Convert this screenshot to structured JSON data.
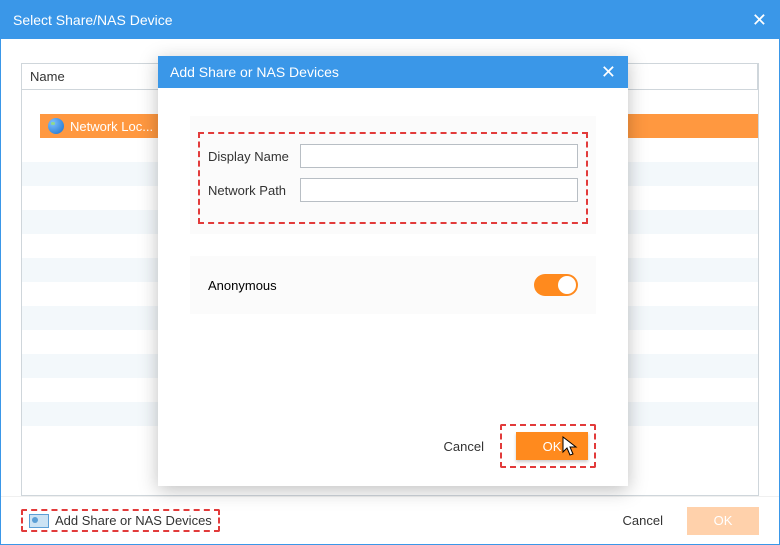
{
  "outer": {
    "title": "Select Share/NAS Device",
    "list": {
      "columns": {
        "name": "Name"
      },
      "selected_item": "Network Loc..."
    },
    "footer": {
      "add_link": "Add Share or NAS Devices",
      "cancel": "Cancel",
      "ok": "OK"
    }
  },
  "inner": {
    "title": "Add Share or NAS Devices",
    "fields": {
      "display_name_label": "Display Name",
      "display_name_value": "",
      "network_path_label": "Network Path",
      "network_path_value": ""
    },
    "anonymous_label": "Anonymous",
    "anonymous_on": true,
    "footer": {
      "cancel": "Cancel",
      "ok": "OK"
    }
  }
}
